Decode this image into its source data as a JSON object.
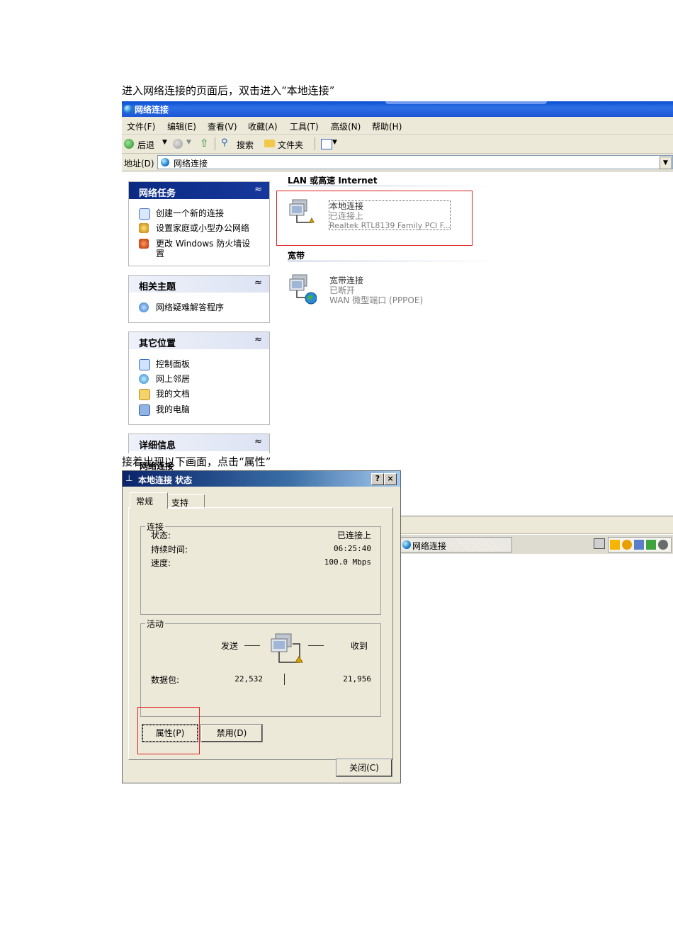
{
  "doc": {
    "caption1": "进入网络连接的页面后，双击进入“本地连接”",
    "caption2": "接着出现以下画面，点击“属性”"
  },
  "explorer": {
    "title": "网络连接",
    "menu": [
      "文件(F)",
      "编辑(E)",
      "查看(V)",
      "收藏(A)",
      "工具(T)",
      "高级(N)",
      "帮助(H)"
    ],
    "toolbar": {
      "back": "后退",
      "search": "搜索",
      "folders": "文件夹"
    },
    "address": {
      "label": "地址(D)",
      "value": "网络连接"
    },
    "panels": {
      "tasks": {
        "title": "网络任务",
        "items": [
          "创建一个新的连接",
          "设置家庭或小型办公网络",
          "更改 Windows 防火墙设置"
        ]
      },
      "related": {
        "title": "相关主题",
        "items": [
          "网络疑难解答程序"
        ]
      },
      "other": {
        "title": "其它位置",
        "items": [
          "控制面板",
          "网上邻居",
          "我的文档",
          "我的电脑"
        ]
      },
      "details": {
        "title": "详细信息",
        "overlap_text": "网络连接"
      }
    },
    "sections": {
      "lan": {
        "title": "LAN 或高速 Internet",
        "name": "本地连接",
        "status": "已连接上",
        "device": "Realtek RTL8139 Family PCI F..."
      },
      "broadband": {
        "title": "宽带",
        "name": "宽带连接",
        "status": "已断开",
        "device": "WAN 微型端口 (PPPOE)"
      }
    },
    "chevron": "≈"
  },
  "dialog": {
    "title": "本地连接 状态",
    "help_btn": "?",
    "close_btn": "×",
    "tabs": [
      "常规",
      "支持"
    ],
    "connection": {
      "legend": "连接",
      "rows": [
        {
          "label": "状态:",
          "value": "已连接上"
        },
        {
          "label": "持续时间:",
          "value": "06:25:40"
        },
        {
          "label": "速度:",
          "value": "100.0 Mbps"
        }
      ]
    },
    "activity": {
      "legend": "活动",
      "sent": "发送",
      "received": "收到",
      "packets_label": "数据包:",
      "packets_sent": "22,532",
      "packets_received": "21,956"
    },
    "buttons": {
      "properties": "属性(P)",
      "disable": "禁用(D)",
      "close": "关闭(C)"
    }
  },
  "taskbar": {
    "task": "网络连接"
  }
}
